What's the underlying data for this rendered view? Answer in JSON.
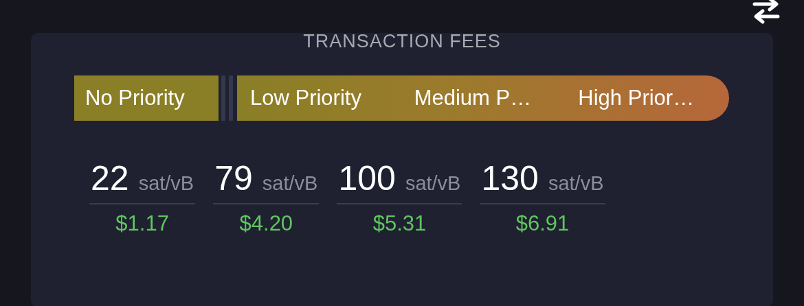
{
  "title": "TRANSACTION FEES",
  "no_priority": {
    "label": "No Priority"
  },
  "priorities": [
    {
      "label": "Low Priority"
    },
    {
      "label": "Medium P…"
    },
    {
      "label": "High Prior…"
    }
  ],
  "fees": [
    {
      "value": "22",
      "unit": "sat/vB",
      "price": "$1.17"
    },
    {
      "value": "79",
      "unit": "sat/vB",
      "price": "$4.20"
    },
    {
      "value": "100",
      "unit": "sat/vB",
      "price": "$5.31"
    },
    {
      "value": "130",
      "unit": "sat/vB",
      "price": "$6.91"
    }
  ]
}
